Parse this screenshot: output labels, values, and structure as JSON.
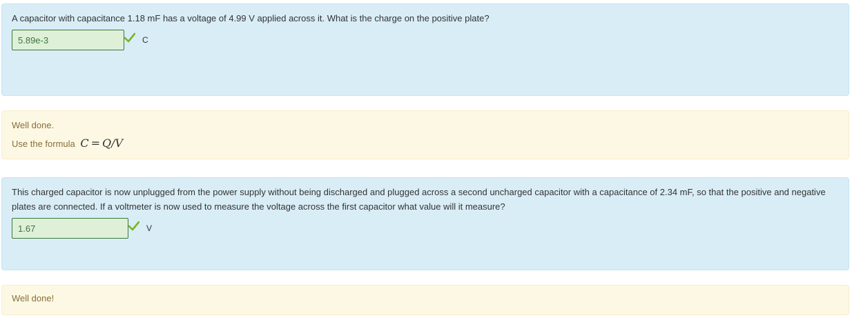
{
  "question1": {
    "prompt": "A capacitor with capacitance 1.18 mF has a voltage of 4.99 V applied across it. What is the charge on the positive plate?",
    "answer_value": "5.89e-3",
    "unit": "C",
    "status_icon": "check-icon",
    "status_color": "#7ab51d"
  },
  "feedback1": {
    "line1": "Well done.",
    "line2_prefix": "Use the formula",
    "formula_lhs": "C",
    "formula_eq": "=",
    "formula_rhs": "Q/V"
  },
  "question2": {
    "prompt": "This charged capacitor is now unplugged from the power supply without being discharged and plugged across a second uncharged capacitor with a capacitance of 2.34 mF, so that the positive and negative plates are connected. If a voltmeter is now used to measure the voltage across the first capacitor what value will it measure?",
    "answer_value": "1.67",
    "unit": "V",
    "status_icon": "check-icon",
    "status_color": "#7ab51d"
  },
  "feedback2": {
    "line1": "Well done!"
  },
  "colors": {
    "question_bg": "#d9edf7",
    "feedback_bg": "#fcf8e3",
    "correct_border": "#3c763d",
    "correct_fill": "#dff0d8"
  }
}
